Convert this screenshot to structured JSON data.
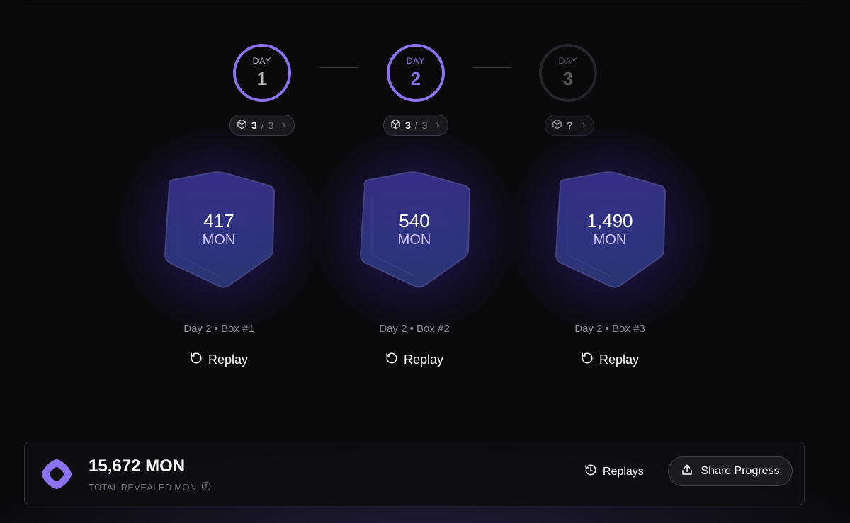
{
  "days": [
    {
      "label": "DAY",
      "number": "1",
      "state": "completed",
      "boxes_opened": "3",
      "separator": "/",
      "boxes_total": "3"
    },
    {
      "label": "DAY",
      "number": "2",
      "state": "current",
      "boxes_opened": "3",
      "separator": "/",
      "boxes_total": "3"
    },
    {
      "label": "DAY",
      "number": "3",
      "state": "locked",
      "boxes_opened": "?",
      "separator": "",
      "boxes_total": ""
    }
  ],
  "boxes": [
    {
      "value": "417",
      "unit": "MON",
      "caption": "Day 2 • Box #1",
      "replay_label": "Replay"
    },
    {
      "value": "540",
      "unit": "MON",
      "caption": "Day 2 • Box #2",
      "replay_label": "Replay"
    },
    {
      "value": "1,490",
      "unit": "MON",
      "caption": "Day 2 • Box #3",
      "replay_label": "Replay"
    }
  ],
  "footer": {
    "total_value": "15,672 MON",
    "total_label": "TOTAL REVEALED MON",
    "replays_label": "Replays",
    "share_label": "Share Progress"
  },
  "colors": {
    "accent": "#8b73f0",
    "background": "#0a0a0b",
    "cube_face": "#2a2570"
  },
  "icons": {
    "box": "cube-icon",
    "chevron": "chevron-right-icon",
    "replay": "rotate-ccw-icon",
    "history": "history-icon",
    "share": "share-icon",
    "info": "info-icon",
    "logo": "monad-logo"
  }
}
